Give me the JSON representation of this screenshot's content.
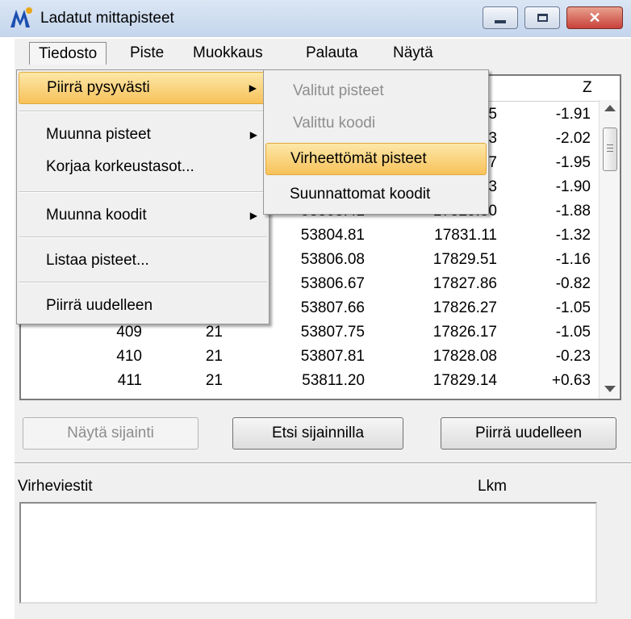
{
  "window": {
    "title": "Ladatut mittapisteet"
  },
  "menubar": {
    "items": [
      "Tiedosto",
      "Piste",
      "Muokkaus",
      "Palauta",
      "Näytä"
    ]
  },
  "table": {
    "z_header": "Z",
    "rows": [
      {
        "id": "",
        "code": "",
        "x": "",
        "y": "5",
        "z": "-1.91"
      },
      {
        "id": "",
        "code": "",
        "x": "",
        "y": "3",
        "z": "-2.02"
      },
      {
        "id": "",
        "code": "",
        "x": "",
        "y": "7",
        "z": "-1.95"
      },
      {
        "id": "",
        "code": "",
        "x": "",
        "y": "3",
        "z": "-1.90"
      },
      {
        "id": "",
        "code": "",
        "x": "53803.41",
        "y": "17829.80",
        "z": "-1.88"
      },
      {
        "id": "",
        "code": "",
        "x": "53804.81",
        "y": "17831.11",
        "z": "-1.32"
      },
      {
        "id": "",
        "code": "",
        "x": "53806.08",
        "y": "17829.51",
        "z": "-1.16"
      },
      {
        "id": "",
        "code": "",
        "x": "53806.67",
        "y": "17827.86",
        "z": "-0.82"
      },
      {
        "id": "",
        "code": "",
        "x": "53807.66",
        "y": "17826.27",
        "z": "-1.05"
      },
      {
        "id": "409",
        "code": "21",
        "x": "53807.75",
        "y": "17826.17",
        "z": "-1.05"
      },
      {
        "id": "410",
        "code": "21",
        "x": "53807.81",
        "y": "17828.08",
        "z": "-0.23"
      },
      {
        "id": "411",
        "code": "21",
        "x": "53811.20",
        "y": "17829.14",
        "z": "+0.63"
      }
    ]
  },
  "buttons": {
    "nayta_sijainti": "Näytä sijainti",
    "etsi_sijainnilla": "Etsi sijainnilla",
    "piirra_uudelleen": "Piirrä uudelleen"
  },
  "bottom": {
    "virheviestit_label": "Virheviestit",
    "lkm_label": "Lkm"
  },
  "file_menu": {
    "items": [
      {
        "label": "Piirrä pysyvästi",
        "submenu": true,
        "highlighted": true
      },
      {
        "label": "Muunna pisteet",
        "submenu": true
      },
      {
        "label": "Korjaa korkeustasot...",
        "submenu": false
      },
      {
        "label": "Muunna koodit",
        "submenu": true
      },
      {
        "label": "Listaa pisteet...",
        "submenu": false
      },
      {
        "label": "Piirrä uudelleen",
        "submenu": false
      }
    ]
  },
  "sub_menu": {
    "items": [
      {
        "label": "Valitut pisteet",
        "disabled": true
      },
      {
        "label": "Valittu koodi",
        "disabled": true
      },
      {
        "label": "Virheettömät pisteet",
        "highlighted": true
      },
      {
        "label": "Suunnattomat koodit"
      }
    ]
  },
  "colors": {
    "highlight": "#f7c25a",
    "close_button": "#c8413a",
    "app_icon": "#1c4fb0"
  }
}
